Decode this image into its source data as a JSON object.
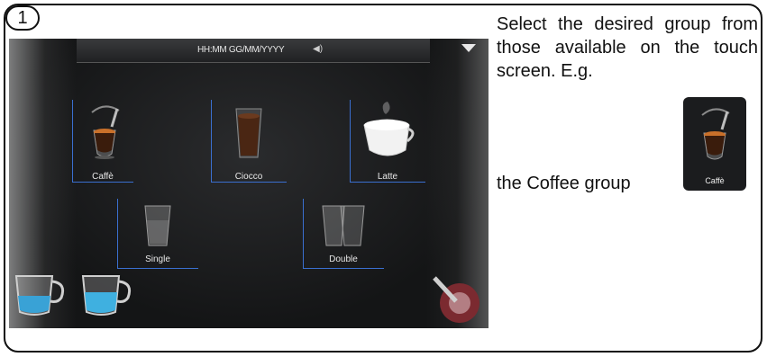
{
  "step": {
    "number": "1"
  },
  "screen": {
    "datetime": "HH:MM GG/MM/YYYY",
    "volume_icon": "speaker-icon",
    "menu_icon": "triangle-down-icon",
    "groups": [
      "Caffè",
      "Ciocco",
      "Latte"
    ],
    "sizes": [
      "Single",
      "Double"
    ]
  },
  "instructions": {
    "line1": "Select the desired group from those available on the touch screen. E.g.",
    "line2": "the Coffee group",
    "thumb_label": "Caffè"
  },
  "colors": {
    "accent": "#3a6fd0",
    "screen_bg": "#141516"
  }
}
